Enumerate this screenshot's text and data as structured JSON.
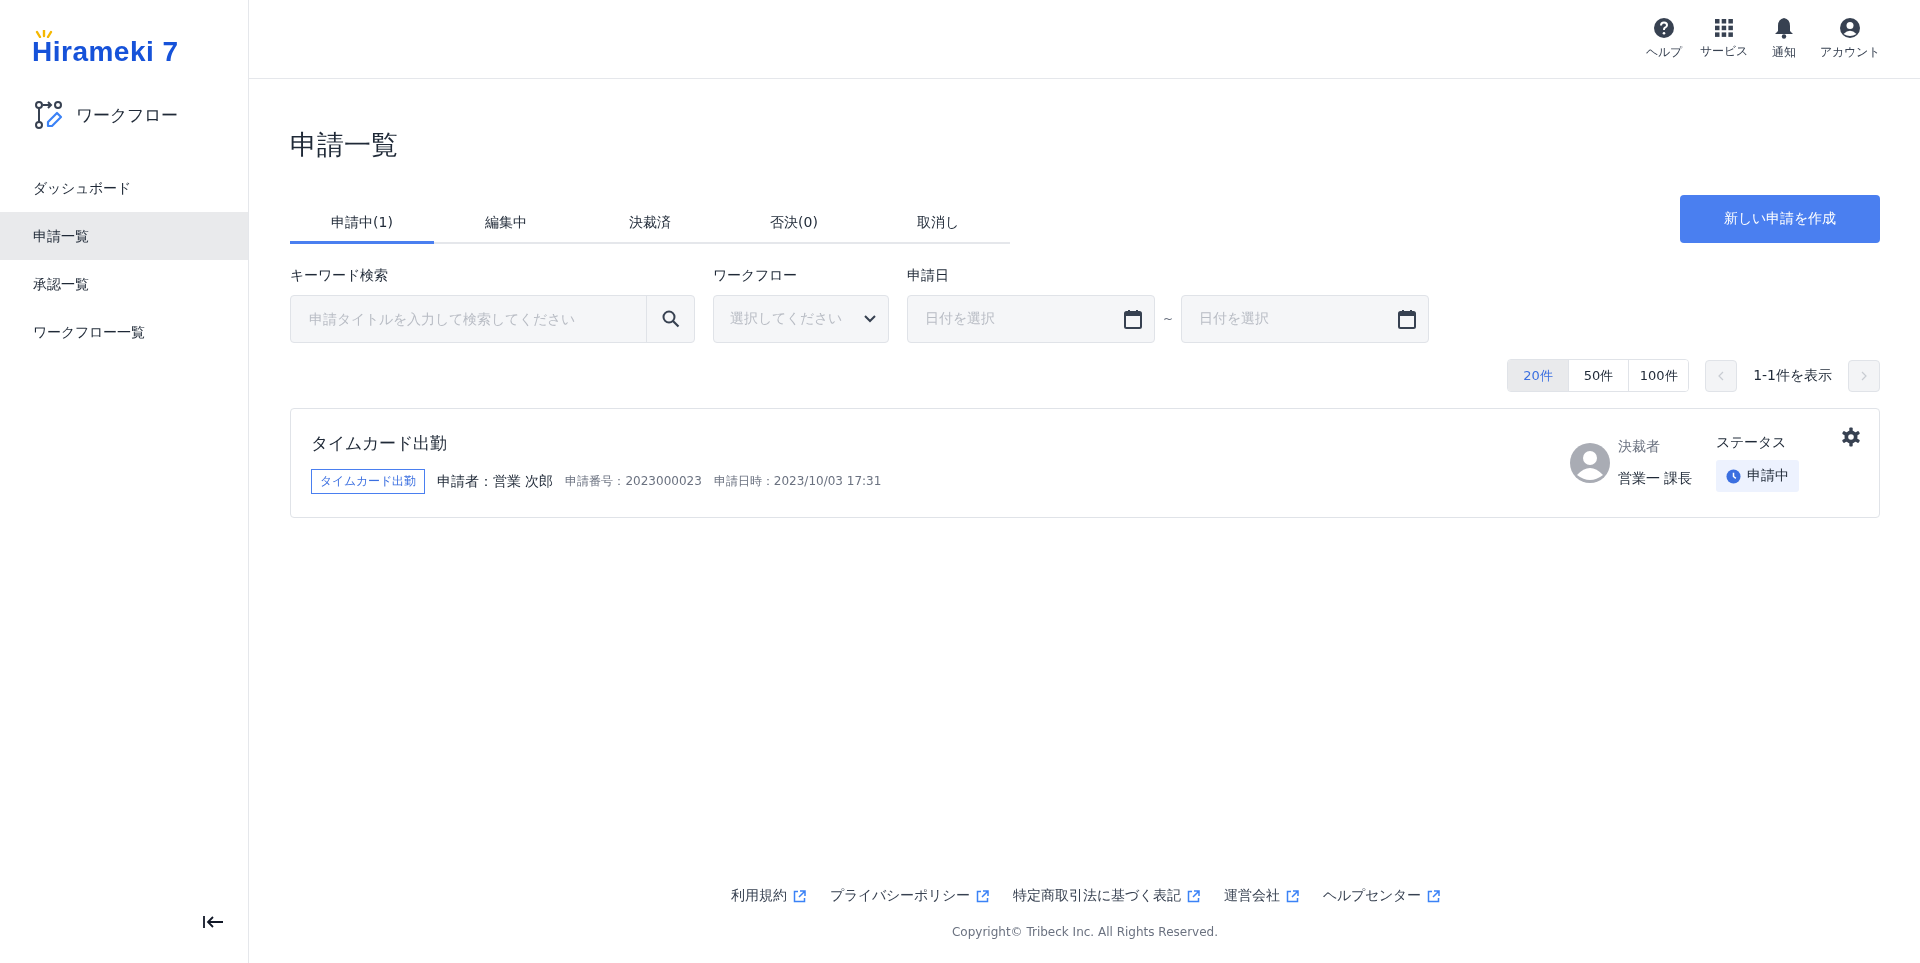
{
  "sidebar": {
    "logo": "Hirameki 7",
    "app": "ワークフロー",
    "items": [
      {
        "label": "ダッシュボード",
        "selected": false
      },
      {
        "label": "申請一覧",
        "selected": true
      },
      {
        "label": "承認一覧",
        "selected": false
      },
      {
        "label": "ワークフロー一覧",
        "selected": false
      }
    ]
  },
  "header": {
    "actions": [
      {
        "kind": "help",
        "label": "ヘルプ"
      },
      {
        "kind": "services",
        "label": "サービス"
      },
      {
        "kind": "notifications",
        "label": "通知"
      },
      {
        "kind": "account",
        "label": "アカウント"
      }
    ]
  },
  "page_title": "申請一覧",
  "tabs": [
    {
      "label": "申請中(1)",
      "selected": true
    },
    {
      "label": "編集中",
      "selected": false
    },
    {
      "label": "決裁済",
      "selected": false
    },
    {
      "label": "否決(0)",
      "selected": false
    },
    {
      "label": "取消し",
      "selected": false
    }
  ],
  "create_button": "新しい申請を作成",
  "filters": {
    "keyword_label": "キーワード検索",
    "keyword_placeholder": "申請タイトルを入力して検索してください",
    "workflow_label": "ワークフロー",
    "workflow_placeholder": "選択してください",
    "date_label": "申請日",
    "date_from_placeholder": "日付を選択",
    "date_separator": "~",
    "date_to_placeholder": "日付を選択"
  },
  "pagination": {
    "page_sizes": [
      {
        "label": "20件",
        "selected": true
      },
      {
        "label": "50件",
        "selected": false
      },
      {
        "label": "100件",
        "selected": false
      }
    ],
    "range": "1-1件を表示"
  },
  "applications": [
    {
      "title": "タイムカード出勤",
      "tag": "タイムカード出勤",
      "applicant": "申請者：営業 次郎",
      "number": "申請番号：2023000023",
      "date": "申請日時：2023/10/03 17:31",
      "approver_label": "決裁者",
      "approver": "営業一 課長",
      "status_label": "ステータス",
      "status": "申請中"
    }
  ],
  "footer": {
    "links": [
      "利用規約",
      "プライバシーポリシー",
      "特定商取引法に基づく表記",
      "運営会社",
      "ヘルプセンター"
    ],
    "copyright": "Copyright© Tribeck Inc. All Rights Reserved."
  }
}
